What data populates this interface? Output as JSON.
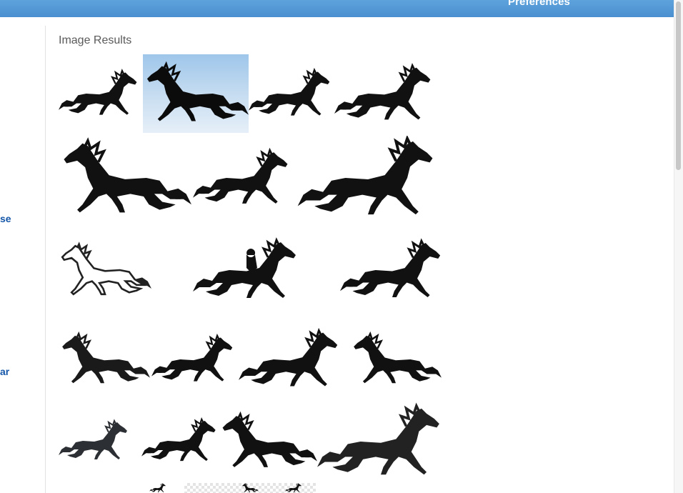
{
  "header": {
    "preferences_label": "Preferences"
  },
  "sidebar": {
    "links": [
      {
        "label": "se"
      },
      {
        "label": "ar"
      }
    ]
  },
  "results": {
    "title": "Image Results",
    "images": [
      {
        "icon": "horse-silhouette-icon",
        "fill": "#111111"
      },
      {
        "icon": "horse-silhouette-icon",
        "fill": "#0b0b0b",
        "selected": true
      },
      {
        "icon": "horse-silhouette-icon",
        "fill": "#111111"
      },
      {
        "icon": "horse-silhouette-icon",
        "fill": "#111111"
      },
      {
        "icon": "horse-silhouette-icon",
        "fill": "#111111"
      },
      {
        "icon": "horse-silhouette-icon",
        "fill": "#111111"
      },
      {
        "icon": "horse-silhouette-icon",
        "fill": "#111111"
      },
      {
        "icon": "horse-sketch-icon",
        "fill": "#222222"
      },
      {
        "icon": "horse-rider-silhouette-icon",
        "fill": "#111111"
      },
      {
        "icon": "horse-silhouette-icon",
        "fill": "#111111"
      },
      {
        "icon": "horse-silhouette-icon",
        "fill": "#1a1a1a"
      },
      {
        "icon": "horse-silhouette-icon",
        "fill": "#111111"
      },
      {
        "icon": "horse-silhouette-icon",
        "fill": "#111111"
      },
      {
        "icon": "horse-silhouette-icon",
        "fill": "#111111"
      },
      {
        "icon": "horse-silhouette-icon",
        "fill": "#2c2f33"
      },
      {
        "icon": "horse-silhouette-icon",
        "fill": "#111111"
      },
      {
        "icon": "horse-silhouette-icon",
        "fill": "#111111"
      },
      {
        "icon": "horse-silhouette-icon",
        "fill": "#222222"
      },
      {
        "icon": "horse-silhouette-icon",
        "fill": "#111111"
      },
      {
        "icon": "horse-silhouette-icon",
        "fill": "#111111"
      },
      {
        "icon": "horse-silhouette-icon",
        "fill": "#111111"
      }
    ]
  },
  "colors": {
    "header": "#4a8fd0",
    "link": "#1456a8",
    "selected_bg": "#b7d4ef"
  }
}
